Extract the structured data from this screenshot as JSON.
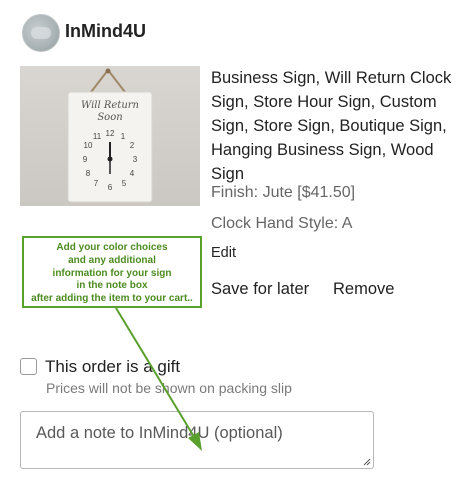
{
  "shop": {
    "name": "InMind4U",
    "avatar_icon": "shop-avatar"
  },
  "listing": {
    "title": "Business Sign, Will Return Clock Sign, Store Hour Sign, Custom Sign, Store Sign, Boutique Sign, Hanging Business Sign, Wood Sign",
    "finish": "Finish: Jute [$41.50]",
    "clock_hand_style": "Clock Hand Style: A",
    "edit_label": "Edit",
    "save_for_later_label": "Save for later",
    "remove_label": "Remove",
    "image": {
      "sign_text_line1": "Will Return",
      "sign_text_line2": "Soon"
    }
  },
  "annotation": {
    "lines": [
      "Add your color choices",
      "and any additional",
      "information for your sign",
      "in the note box",
      "after adding the item to your cart.."
    ],
    "color": "#5aa02c"
  },
  "gift": {
    "label": "This order is a gift",
    "sublabel": "Prices will not be shown on packing slip",
    "checked": false
  },
  "note": {
    "placeholder": "Add a note to InMind4U (optional)"
  }
}
